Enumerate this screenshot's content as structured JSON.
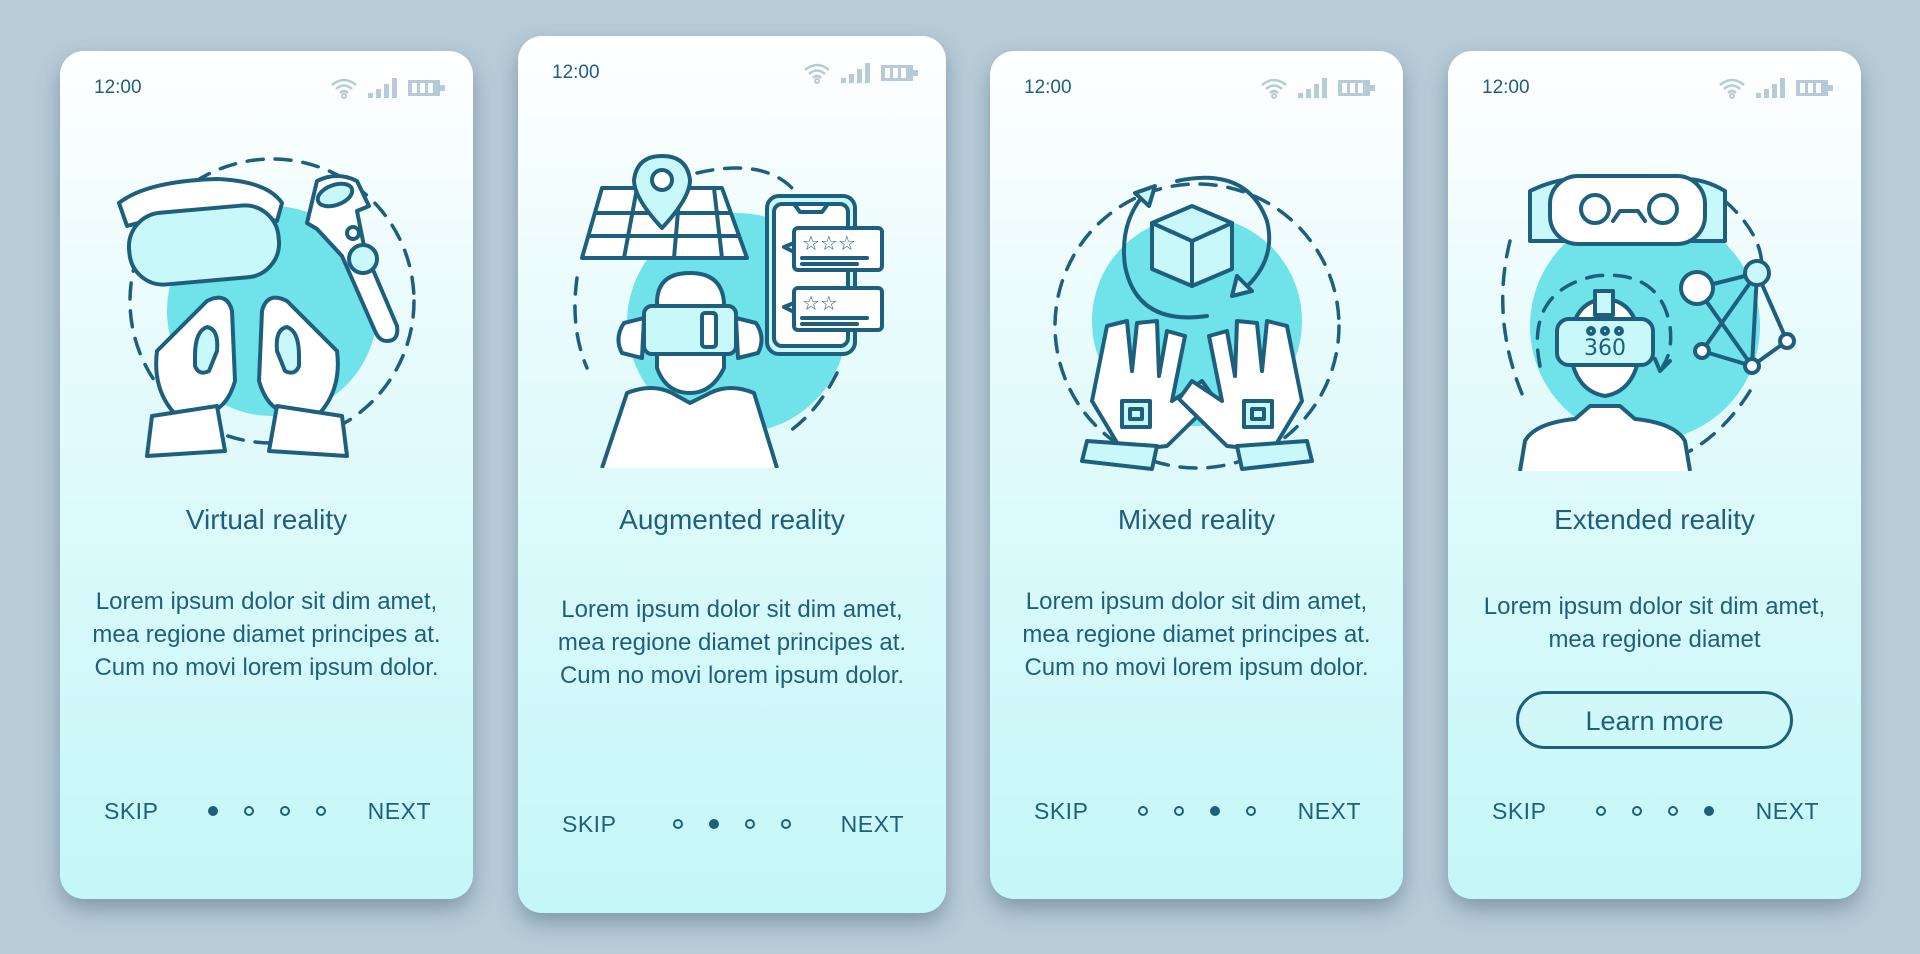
{
  "colors": {
    "background": "#b8ccd8",
    "text": "#1f5f7e",
    "accent": "#6fe2ea",
    "card_top": "#ffffff",
    "card_bottom": "#c4f7f8",
    "status_icons": "#b7cbd6"
  },
  "status_bar": {
    "time": "12:00",
    "icons": [
      "wifi-icon",
      "signal-icon",
      "battery-icon"
    ]
  },
  "screens": [
    {
      "illustration": "vr-headset-controllers-icon",
      "title": "Virtual reality",
      "description": "Lorem ipsum dolor sit dim amet, mea regione diamet principes at. Cum no movi lorem ipsum dolor.",
      "skip": "SKIP",
      "next": "NEXT",
      "page_count": 4,
      "active_page": 1
    },
    {
      "illustration": "ar-map-phone-reviews-icon",
      "title": "Augmented reality",
      "description": "Lorem ipsum dolor sit dim amet, mea regione diamet principes at. Cum no movi lorem ipsum dolor.",
      "skip": "SKIP",
      "next": "NEXT",
      "page_count": 4,
      "active_page": 2
    },
    {
      "illustration": "mr-cube-gloves-icon",
      "title": "Mixed reality",
      "description": "Lorem ipsum dolor sit dim amet, mea regione diamet principes at. Cum no movi lorem ipsum dolor.",
      "skip": "SKIP",
      "next": "NEXT",
      "page_count": 4,
      "active_page": 3
    },
    {
      "illustration": "xr-360-headset-network-icon",
      "title": "Extended reality",
      "description": "Lorem ipsum dolor sit dim amet, mea regione diamet",
      "button": "Learn more",
      "skip": "SKIP",
      "next": "NEXT",
      "page_count": 4,
      "active_page": 4
    }
  ],
  "illustration_text": {
    "xr_headset_label": "360"
  }
}
